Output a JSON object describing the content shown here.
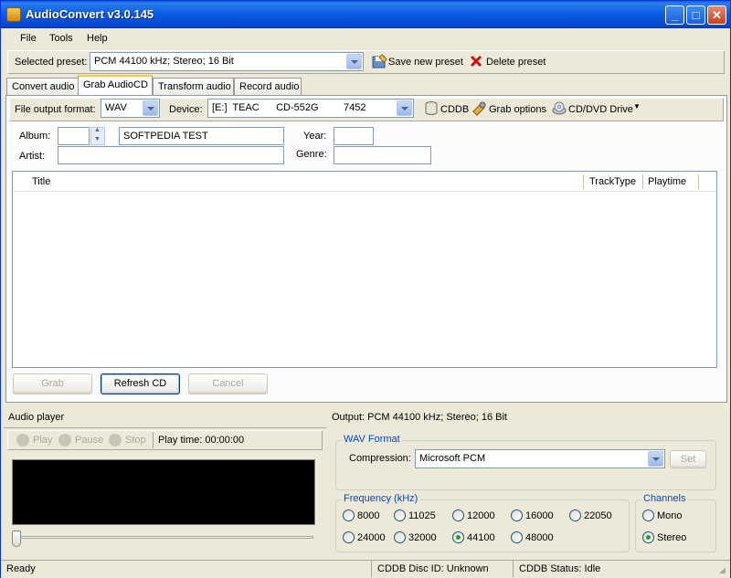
{
  "window": {
    "title": "AudioConvert v3.0.145"
  },
  "menu": [
    "File",
    "Tools",
    "Help"
  ],
  "preset": {
    "label": "Selected preset:",
    "value": "PCM 44100 kHz; Stereo; 16 Bit",
    "save_label": "Save new preset",
    "delete_label": "Delete preset"
  },
  "tabs": [
    "Convert audio",
    "Grab AudioCD",
    "Transform audio",
    "Record audio"
  ],
  "grab": {
    "format_label": "File output format:",
    "format_value": "WAV",
    "device_label": "Device:",
    "device_value": "[E:]  TEAC      CD-552G         7452",
    "cddb_label": "CDDB",
    "grab_options_label": "Grab options",
    "drive_label": "CD/DVD Drive",
    "album_label": "Album:",
    "album_value": "SOFTPEDIA TEST",
    "artist_label": "Artist:",
    "year_label": "Year:",
    "genre_label": "Genre:",
    "columns": [
      "Title",
      "TrackType",
      "Playtime"
    ],
    "buttons": {
      "grab": "Grab",
      "refresh": "Refresh CD",
      "cancel": "Cancel"
    }
  },
  "player": {
    "header": "Audio player",
    "play": "Play",
    "pause": "Pause",
    "stop": "Stop",
    "time_label": "Play time: 00:00:00"
  },
  "output": {
    "header": "Output: PCM 44100 kHz; Stereo; 16 Bit",
    "wav_format_title": "WAV Format",
    "compression_label": "Compression:",
    "compression_value": "Microsoft PCM",
    "set_label": "Set",
    "frequency_title": "Frequency (kHz)",
    "frequencies": [
      "8000",
      "11025",
      "12000",
      "16000",
      "22050",
      "24000",
      "32000",
      "44100",
      "48000"
    ],
    "selected_frequency": "44100",
    "channels_title": "Channels",
    "channels": [
      "Mono",
      "Stereo"
    ],
    "selected_channel": "Stereo"
  },
  "status": {
    "state": "Ready",
    "disc_id": "CDDB Disc ID: Unknown",
    "cddb_status": "CDDB Status: Idle"
  },
  "colors": {
    "accent": "#0046d5",
    "selected_radio": "#21a121",
    "player_screen": "#000000"
  }
}
